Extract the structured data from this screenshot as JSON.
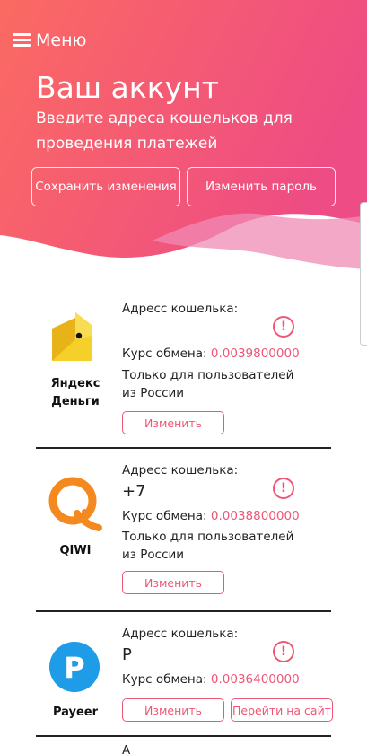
{
  "header": {
    "menu_label": "Меню",
    "title": "Ваш аккунт",
    "subtitle": "Введите адреса кошельков для проведения платежей",
    "save_button": "Сохранить изменения",
    "change_password_button": "Изменить пароль"
  },
  "colors": {
    "gradient_left": "#fb6a63",
    "gradient_right": "#ef4d82",
    "accent": "#ef5676"
  },
  "wallets": [
    {
      "name_line1": "Яндекс",
      "name_line2": "Деньги",
      "icon": "yandex-money-icon",
      "address_label": "Адресс кошелька:",
      "address_value": "",
      "rate_label": "Курс обмена:",
      "rate_value": "0.0039800000",
      "note": "Только для пользователей из России",
      "edit_button": "Изменить"
    },
    {
      "name_line1": "QIWI",
      "icon": "qiwi-icon",
      "address_label": "Адресс кошелька:",
      "address_value": "+7",
      "rate_label": "Курс обмена:",
      "rate_value": "0.0038800000",
      "note": "Только для пользователей из России",
      "edit_button": "Изменить"
    },
    {
      "name_line1": "Payeer",
      "icon": "payeer-icon",
      "address_label": "Адресс кошелька:",
      "address_value": "P",
      "rate_label": "Курс обмена:",
      "rate_value": "0.0036400000",
      "edit_button": "Изменить",
      "goto_button": "Перейти на сайт"
    }
  ],
  "next_row_partial": "А"
}
